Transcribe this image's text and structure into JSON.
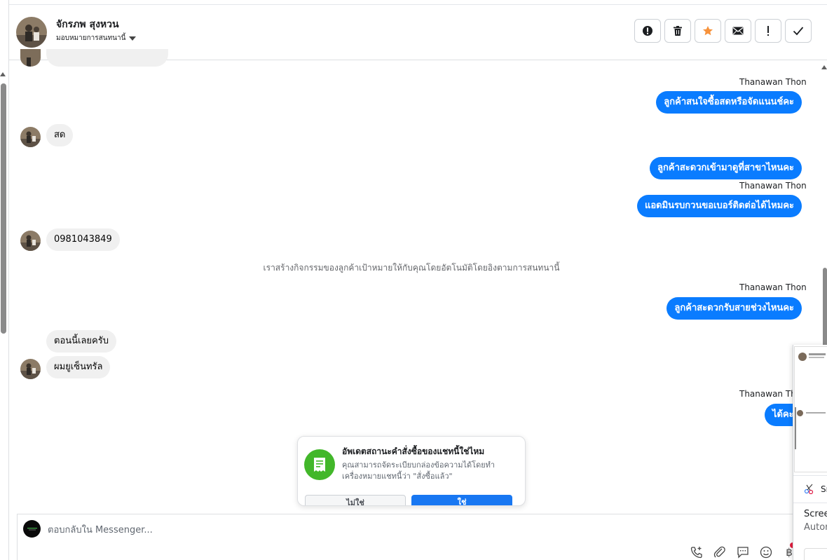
{
  "header": {
    "contact_name": "จักรภพ สุงหวน",
    "assign_label": "มอบหมายการสนทนานี้",
    "actions": [
      {
        "icon": "alert-circle-icon",
        "name": "spam-button"
      },
      {
        "icon": "trash-icon",
        "name": "delete-button"
      },
      {
        "icon": "star-icon",
        "name": "star-button"
      },
      {
        "icon": "envelope-icon",
        "name": "mark-unread-button"
      },
      {
        "icon": "exclamation-icon",
        "name": "follow-up-button"
      },
      {
        "icon": "check-icon",
        "name": "mark-done-button"
      }
    ]
  },
  "messages": {
    "sender_name": "Thanawan Thon",
    "out_1": "ลูกค้าสนใจซื้อสดหรือจัดแนนช์คะ",
    "in_1": "สด",
    "out_2": "ลูกค้าสะดวกเข้ามาดูที่สาขาไหนคะ",
    "out_3": "แอดมินรบกวนขอเบอร์ติดต่อได้ไหมคะ",
    "in_2": "0981043849",
    "system_note": "เราสร้างกิจกรรมของลูกค้าเป้าหมายให้กับคุณโดยอัตโนมัติโดยอิงตามการสนทนานี้",
    "out_4": "ลูกค้าสะดวกรับสายช่วงไหนคะ",
    "in_3": "ตอนนี้เลยครับ",
    "in_4": "ผมยูเซ็นทรัล",
    "sender_name_partial": "Thanawan Tho",
    "out_5_partial": "ได้คะ"
  },
  "order_card": {
    "title": "อัพเดตสถานะคำสั่งซื้อของแชทนี้ใช่ไหม",
    "description": "คุณสามารถจัดระเบียบกล่องข้อความได้โดยทำเครื่องหมายแชทนี้ว่า \"สั่งซื้อแล้ว\"",
    "no_label": "ไม่ใช่",
    "yes_label": "ใช่"
  },
  "composer": {
    "placeholder": "ตอบกลับใน Messenger...",
    "tools": [
      "phone-plus-icon",
      "paperclip-icon",
      "saved-reply-icon",
      "emoji-icon",
      "baht-icon"
    ],
    "baht_symbol": "฿"
  },
  "overlay": {
    "sn_text": "Sn",
    "screen_text": "Scree",
    "auto_text": "Autor"
  },
  "colors": {
    "outgoing_bubble": "#0a7cff",
    "incoming_bubble": "#f0f0f0",
    "confirm_button": "#1877f2",
    "order_icon_bg": "#42b72a",
    "star": "#f7923b"
  }
}
